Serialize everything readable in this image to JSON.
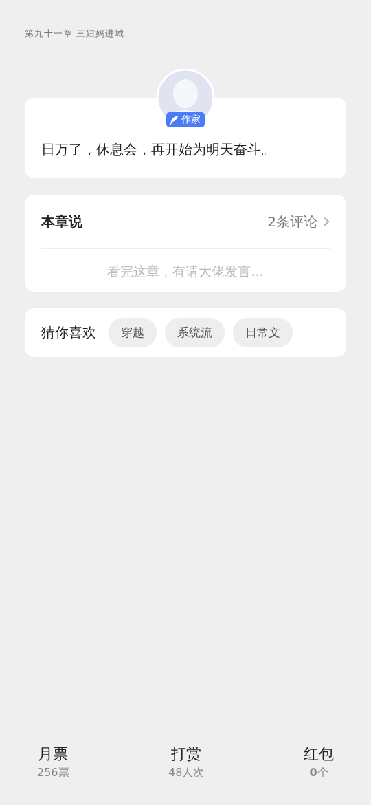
{
  "chapter_title": "第九十一章 三妞妈进城",
  "author_note": {
    "badge": "作家",
    "text": "日万了，休息会，再开始为明天奋斗。"
  },
  "comments": {
    "title": "本章说",
    "count": "2条评论",
    "placeholder": "看完这章，有请大佬发言..."
  },
  "recommend": {
    "label": "猜你喜欢",
    "tags": [
      "穿越",
      "系统流",
      "日常文"
    ]
  },
  "bottom_bar": [
    {
      "label": "月票",
      "value": "256票"
    },
    {
      "label": "打赏",
      "value": "48人次"
    },
    {
      "label": "红包",
      "value": "**0**个"
    }
  ]
}
